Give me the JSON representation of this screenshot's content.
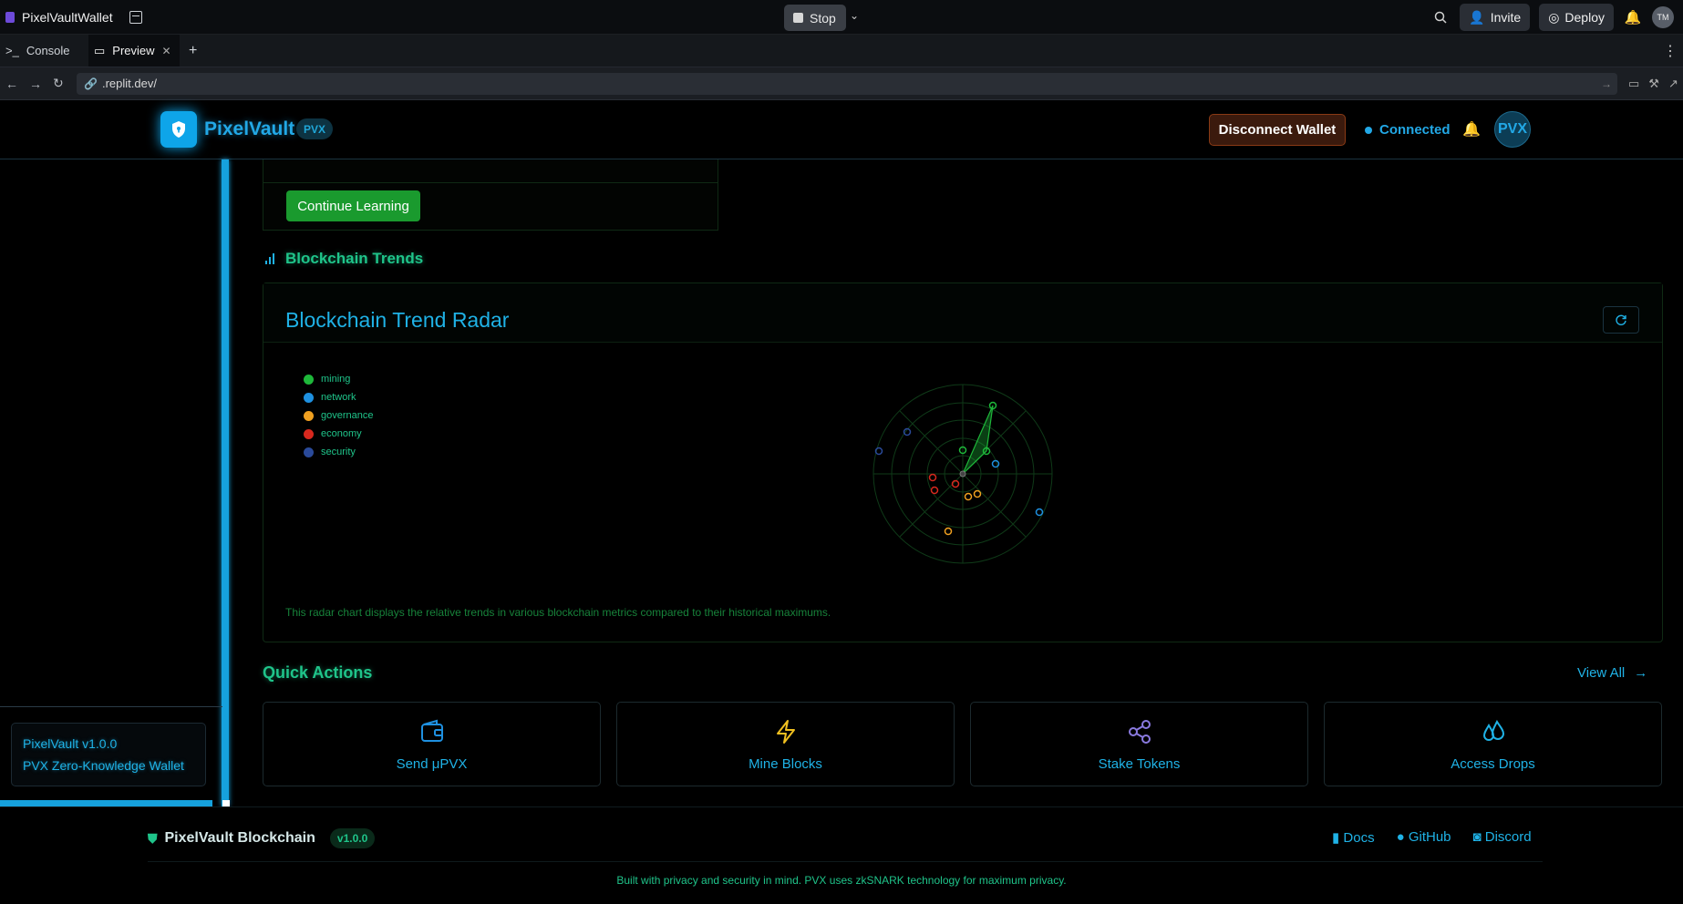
{
  "replit": {
    "app_name": "PixelVaultWallet",
    "stop_label": "Stop",
    "invite_label": "Invite",
    "deploy_label": "Deploy",
    "avatar_initials": "TM",
    "tabs": [
      {
        "label": "Console"
      },
      {
        "label": "Preview"
      }
    ],
    "url": ".replit.dev/"
  },
  "header": {
    "logo_text": "PixelVault",
    "logo_badge": "PVX",
    "disconnect_label": "Disconnect  Wallet",
    "status_text": "Connected",
    "avatar_text": "PVX"
  },
  "sidebar": {
    "version": "PixelVault v1.0.0",
    "subtitle": "PVX Zero-Knowledge Wallet"
  },
  "learning": {
    "continue_label": "Continue Learning"
  },
  "trends": {
    "section_title": "Blockchain Trends",
    "card_title": "Blockchain Trend Radar",
    "note": "This radar chart displays the relative trends in various blockchain metrics compared to their historical maximums.",
    "legend": [
      {
        "label": "mining",
        "color": "#1eb83a"
      },
      {
        "label": "network",
        "color": "#1e90e0"
      },
      {
        "label": "governance",
        "color": "#f0a020"
      },
      {
        "label": "economy",
        "color": "#d8281e"
      },
      {
        "label": "security",
        "color": "#2a4a9a"
      }
    ]
  },
  "quick_actions": {
    "title": "Quick Actions",
    "view_all": "View All",
    "items": [
      {
        "label": "Send μPVX",
        "icon": "wallet-icon",
        "color": "#1e90e0"
      },
      {
        "label": "Mine Blocks",
        "icon": "lightning-icon",
        "color": "#f0c020"
      },
      {
        "label": "Stake Tokens",
        "icon": "share-icon",
        "color": "#8a7ae0"
      },
      {
        "label": "Access Drops",
        "icon": "droplets-icon",
        "color": "#1fb2e6"
      }
    ]
  },
  "footer": {
    "brand": "PixelVault Blockchain",
    "version": "v1.0.0",
    "links": [
      "Docs",
      "GitHub",
      "Discord"
    ],
    "note": "Built with privacy and security in mind. PVX uses zkSNARK technology for maximum privacy."
  }
}
